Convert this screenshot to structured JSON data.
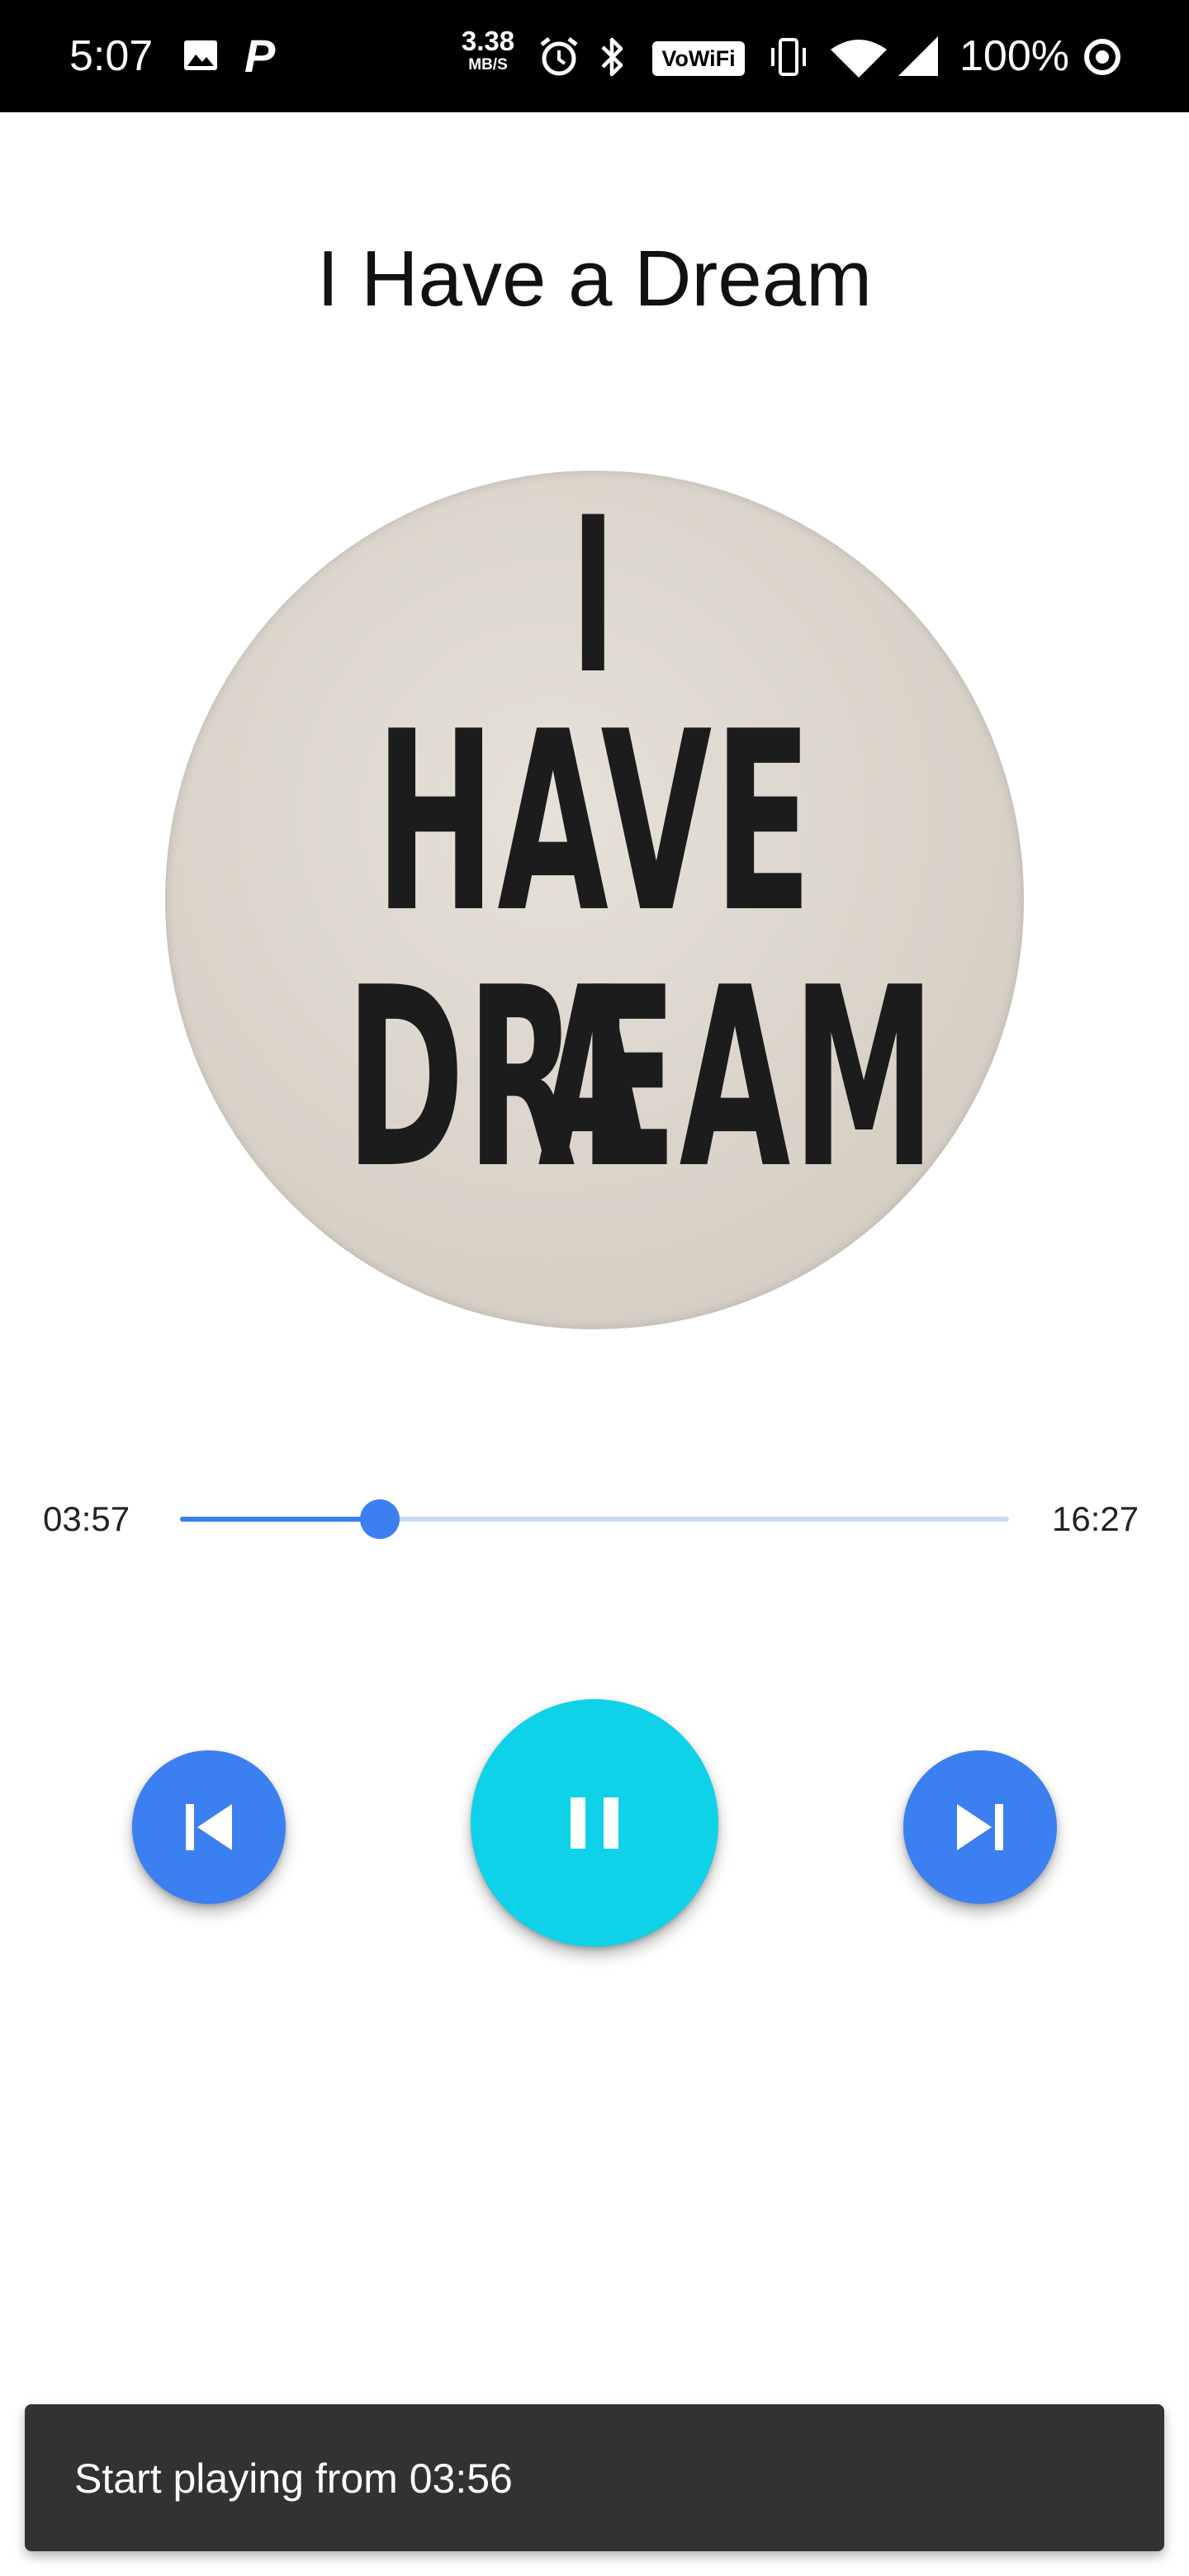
{
  "status_bar": {
    "time": "5:07",
    "carrier_icon_letter": "P",
    "net_speed_value": "3.38",
    "net_speed_unit": "MB/S",
    "vowifi_label": "VoWiFi",
    "battery_percent": "100%",
    "icons": [
      "photo-icon",
      "p-app-icon",
      "alarm-icon",
      "bluetooth-icon",
      "vowifi-icon",
      "vibrate-icon",
      "wifi-icon",
      "signal-icon",
      "ring-icon"
    ]
  },
  "player": {
    "title": "I Have a Dream",
    "album_art_lines": [
      "I",
      "HAVE A",
      "DREAM"
    ],
    "current_time": "03:57",
    "total_time": "16:27",
    "progress_fraction": 0.241,
    "controls": {
      "previous_icon": "skip-previous-icon",
      "play_pause_icon": "pause-icon",
      "next_icon": "skip-next-icon"
    }
  },
  "snackbar": {
    "message": "Start playing from 03:56"
  },
  "colors": {
    "accent_blue": "#3b7ff0",
    "play_button": "#0fd1e8",
    "seek_track": "#c7dbf6",
    "snackbar_bg": "#323232"
  }
}
